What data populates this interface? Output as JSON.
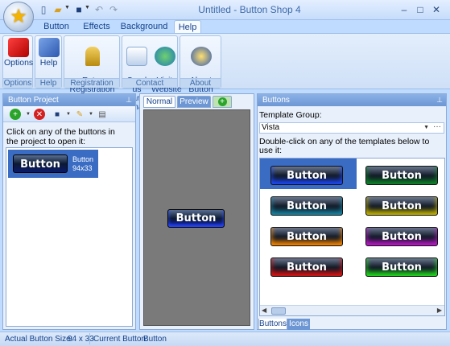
{
  "window": {
    "title": "Untitled - Button Shop 4"
  },
  "ribbon_tabs": [
    "Button",
    "Effects",
    "Background",
    "Help"
  ],
  "ribbon": {
    "groups": [
      {
        "label": "Options",
        "buttons": [
          "Options"
        ]
      },
      {
        "label": "Help",
        "buttons": [
          "Help"
        ]
      },
      {
        "label": "Registration",
        "buttons": [
          "Enter\nRegistration Key"
        ]
      },
      {
        "label": "Contact",
        "buttons": [
          "Send us\nan email",
          "Visit\nWebsite"
        ]
      },
      {
        "label": "About",
        "buttons": [
          "About\nButton Shop"
        ]
      }
    ]
  },
  "left_pane": {
    "title": "Button Project",
    "help_text": "Click on any of the buttons in the project to open it:",
    "item": {
      "button_text": "Button",
      "name": "Button",
      "size": "94x33"
    }
  },
  "center_pane": {
    "tabs": [
      "Normal",
      "Preview"
    ],
    "preview_button": "Button"
  },
  "right_pane": {
    "title": "Buttons",
    "template_group_label": "Template Group:",
    "template_group_value": "Vista",
    "instruction": "Double-click on any of the templates below to use it:",
    "templates": [
      {
        "label": "Button",
        "glow": "#1f4cff"
      },
      {
        "label": "Button",
        "glow": "#0f8a2c"
      },
      {
        "label": "Button",
        "glow": "#1a8aa8"
      },
      {
        "label": "Button",
        "glow": "#c8b800"
      },
      {
        "label": "Button",
        "glow": "#ff8a00"
      },
      {
        "label": "Button",
        "glow": "#c21ad0"
      },
      {
        "label": "Button",
        "glow": "#e01515"
      },
      {
        "label": "Button",
        "glow": "#24e020"
      }
    ],
    "bottom_tabs": [
      "Buttons",
      "Icons"
    ]
  },
  "status": {
    "size_label": "Actual Button Size:",
    "size_value": "94 x 33",
    "current_label": "Current Button:",
    "current_value": "Button"
  }
}
